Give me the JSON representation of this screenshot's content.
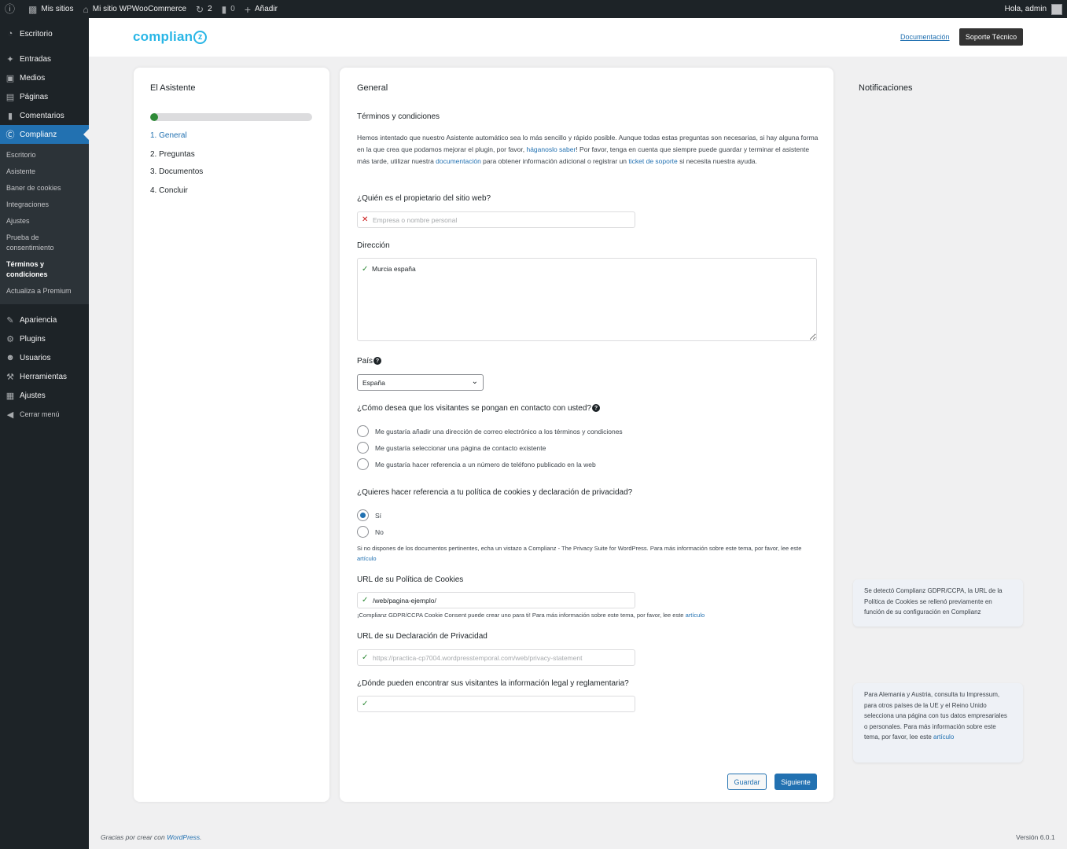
{
  "adminbar": {
    "wp_logo_icon": "wordpress-icon",
    "my_sites": "Mis sitios",
    "site_name": "Mi sitio WPWooCommerce",
    "updates_count": "2",
    "comments_count": "0",
    "add_new": "Añadir",
    "greeting": "Hola, admin"
  },
  "sidebar": {
    "items": [
      {
        "label": "Escritorio",
        "icon": "dashboard-icon"
      },
      {
        "label": "Entradas",
        "icon": "pin-icon"
      },
      {
        "label": "Medios",
        "icon": "media-icon"
      },
      {
        "label": "Páginas",
        "icon": "pages-icon"
      },
      {
        "label": "Comentarios",
        "icon": "comments-icon"
      },
      {
        "label": "Complianz",
        "icon": "complianz-icon"
      },
      {
        "label": "Apariencia",
        "icon": "appearance-icon"
      },
      {
        "label": "Plugins",
        "icon": "plugins-icon"
      },
      {
        "label": "Usuarios",
        "icon": "users-icon"
      },
      {
        "label": "Herramientas",
        "icon": "tools-icon"
      },
      {
        "label": "Ajustes",
        "icon": "settings-icon"
      },
      {
        "label": "Cerrar menú",
        "icon": "collapse-icon"
      }
    ],
    "submenu": [
      "Escritorio",
      "Asistente",
      "Baner de cookies",
      "Integraciones",
      "Ajustes",
      "Prueba de consentimiento",
      "Términos y condiciones",
      "Actualiza a Premium"
    ]
  },
  "header": {
    "logo_text": "complian",
    "logo_mark": "z",
    "doc_link": "Documentación",
    "support_button": "Soporte Técnico"
  },
  "wizard": {
    "title": "El Asistente",
    "progress": 0.05,
    "steps": [
      "1. General",
      "2. Preguntas",
      "3. Documentos",
      "4. Concluir"
    ]
  },
  "general": {
    "title": "General",
    "section_title": "Términos y condiciones",
    "intro_1": "Hemos intentado que nuestro Asistente automático sea lo más sencillo y rápido posible. Aunque todas estas preguntas son necesarias, si hay alguna forma en la que crea que podamos mejorar el plugin, por favor, ",
    "intro_link_1": "háganoslo saber",
    "intro_2": "!  Por favor, tenga en cuenta que siempre puede guardar y terminar el asistente más tarde, utilizar nuestra ",
    "intro_link_2": "documentación",
    "intro_3": " para obtener información adicional o registrar un ",
    "intro_link_3": "ticket de soporte",
    "intro_4": " si necesita nuestra ayuda.",
    "owner_label": "¿Quién es el propietario del sitio web?",
    "owner_placeholder": "Empresa o nombre personal",
    "address_label": "Dirección",
    "address_value": "Murcia españa",
    "country_label": "País",
    "country_value": "España",
    "contact_label": "¿Cómo desea que los visitantes se pongan en contacto con usted?",
    "contact_options": [
      "Me gustaría añadir una dirección de correo electrónico a los términos y condiciones",
      "Me gustaría seleccionar una página de contacto existente",
      "Me gustaría hacer referencia a un número de teléfono publicado en la web"
    ],
    "policy_label": "¿Quieres hacer referencia a tu política de cookies y declaración de privacidad?",
    "policy_options": [
      "Sí",
      "No"
    ],
    "policy_note": "Si no dispones de los documentos pertinentes, echa un vistazo a Complianz - The Privacy Suite for WordPress. Para más información sobre este tema, por favor, lee este ",
    "policy_note_link": "artículo",
    "cookie_url_label": "URL de su Política de Cookies",
    "cookie_url_value": "/web/pagina-ejemplo/",
    "cookie_url_note": "¡Complianz GDPR/CCPA Cookie Consent puede crear uno para ti! Para más información sobre este tema, por favor, lee este ",
    "cookie_url_note_link": "artículo",
    "privacy_url_label": "URL de su Declaración de Privacidad",
    "privacy_url_placeholder": "https://practica-cp7004.wordpresstemporal.com/web/privacy-statement",
    "legal_label": "¿Dónde pueden encontrar sus visitantes la información legal y reglamentaria?",
    "save_button": "Guardar",
    "next_button": "Siguiente"
  },
  "notifications": {
    "title": "Notificaciones",
    "tip_1": "Se detectó Complianz GDPR/CCPA, la URL de la Política de Cookies se rellenó previamente en función de su configuración en Complianz",
    "tip_2": "Para Alemania y Austria, consulta tu Impressum, para otros países de la UE y el Reino Unido selecciona una página con tus datos empresariales o personales. Para más información sobre este tema, por favor, lee este ",
    "tip_2_link": "artículo"
  },
  "footer": {
    "thanks": "Gracias por crear con ",
    "wp_link": "WordPress",
    "thanks_end": ".",
    "version": "Versión 6.0.1"
  },
  "colors": {
    "accent": "#2271b1",
    "admin_dark": "#1d2327",
    "success": "#2e8a37",
    "error": "#cc1818",
    "logo": "#29b6e6"
  }
}
